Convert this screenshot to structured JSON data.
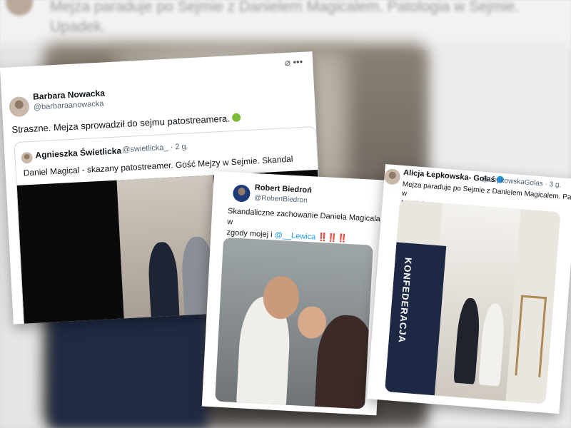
{
  "background": {
    "text_line1": "Mejza paraduje po Sejmie z Danielem Magicalem. Patologia w Sejmie.",
    "text_line2": "Upadek."
  },
  "tweet1": {
    "name": "Barbara Nowacka",
    "handle": "@barbaraanowacka",
    "text": "Straszne. Mejza sprowadził do sejmu patostreamera.",
    "quote": {
      "name": "Agnieszka Świetlicka",
      "handle": "@swietlicka_ · 2 g.",
      "text": "Daniel Magical - skazany patostreamer. Gość Mejzy w Sejmie. Skandal"
    }
  },
  "tweet2": {
    "name": "Robert Biedroń",
    "handle": "@RobertBiedron",
    "text": "Skandaliczne zachowanie Daniela Magicala w",
    "text2": "zgody mojej i",
    "mention": "@__Lewica",
    "exclaim": "‼️‼️‼️"
  },
  "tweet3": {
    "name": "Alicja Łepkowska- Gołaś",
    "handle": "@LepkowskaGolas · 3 g.",
    "text": "Mejza paraduje po Sejmie z Danielem Magicalem. Patologia w",
    "text2": "Upadek.",
    "banner_text": "KONFEDERACJA"
  }
}
